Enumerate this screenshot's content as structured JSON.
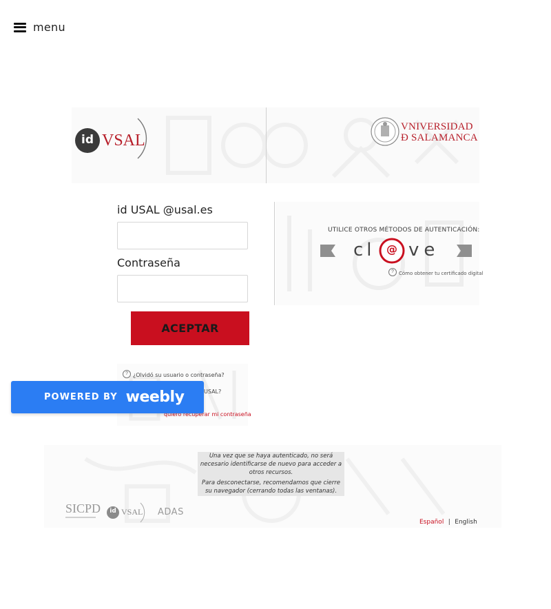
{
  "menu": {
    "label": "menu"
  },
  "header": {
    "idusal_logo": {
      "id": "id",
      "vsal": "VSAL"
    },
    "university_logo": {
      "line1": "VNIVERSIDAD",
      "line2": "Ð SALAMANCA"
    }
  },
  "login": {
    "user_label": "id USAL @usal.es",
    "user_value": "",
    "password_label": "Contraseña",
    "password_value": "",
    "accept_label": "ACEPTAR"
  },
  "alt_auth": {
    "title": "UTILICE OTROS MÉTODOS DE AUTENTICACIÓN:",
    "clave_text": {
      "c": "cl",
      "at": "@",
      "ve": "ve"
    },
    "certificate_link": "Cómo obtener tu certificado digital"
  },
  "help": {
    "forgot": "¿Olvidó su usuario o contraseña?",
    "idusal_question": "USAL?",
    "recover_link": "quiero recuperar mi contraseña"
  },
  "weebly": {
    "powered_by": "POWERED BY",
    "brand": "weebly"
  },
  "notice": {
    "paragraph1": "Una vez que se haya autenticado, no será necesario identificarse de nuevo para acceder a otros recursos.",
    "paragraph2": "Para desconectarse, recomendamos que cierre su navegador (cerrando todas las ventanas)."
  },
  "footer": {
    "logos": {
      "sicpd": "SICPD",
      "idusal_id": "id",
      "idusal_vsal": "VSAL",
      "adas": "ADAS"
    },
    "lang_es": "Español",
    "lang_sep": "|",
    "lang_en": "English"
  },
  "colors": {
    "accent_red": "#c90f1f",
    "weebly_blue": "#2b7df3",
    "notice_bg": "#e6e6e6"
  }
}
